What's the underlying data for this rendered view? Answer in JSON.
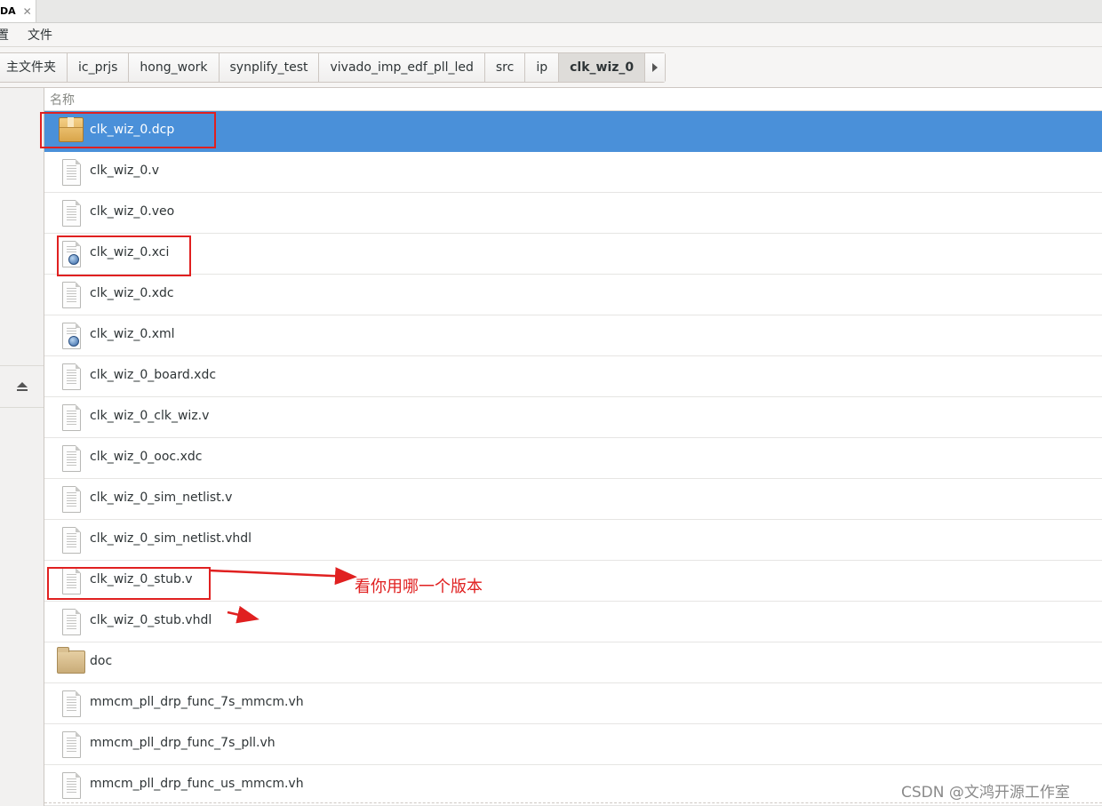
{
  "window_tab": {
    "label": "DA",
    "close_glyph": "✕"
  },
  "menu": {
    "items": [
      "置",
      "文件"
    ]
  },
  "breadcrumbs": [
    "主文件夹",
    "ic_prjs",
    "hong_work",
    "synplify_test",
    "vivado_imp_edf_pll_led",
    "src",
    "ip",
    "clk_wiz_0"
  ],
  "breadcrumb_active_index": 7,
  "list": {
    "column_header": "名称",
    "files": [
      {
        "name": "clk_wiz_0.dcp",
        "icon": "package-icon",
        "selected": true
      },
      {
        "name": "clk_wiz_0.v",
        "icon": "text-file-icon"
      },
      {
        "name": "clk_wiz_0.veo",
        "icon": "text-file-icon"
      },
      {
        "name": "clk_wiz_0.xci",
        "icon": "web-file-icon"
      },
      {
        "name": "clk_wiz_0.xdc",
        "icon": "text-file-icon"
      },
      {
        "name": "clk_wiz_0.xml",
        "icon": "web-file-icon"
      },
      {
        "name": "clk_wiz_0_board.xdc",
        "icon": "text-file-icon"
      },
      {
        "name": "clk_wiz_0_clk_wiz.v",
        "icon": "text-file-icon"
      },
      {
        "name": "clk_wiz_0_ooc.xdc",
        "icon": "text-file-icon"
      },
      {
        "name": "clk_wiz_0_sim_netlist.v",
        "icon": "text-file-icon"
      },
      {
        "name": "clk_wiz_0_sim_netlist.vhdl",
        "icon": "text-file-icon"
      },
      {
        "name": "clk_wiz_0_stub.v",
        "icon": "text-file-icon"
      },
      {
        "name": "clk_wiz_0_stub.vhdl",
        "icon": "text-file-icon"
      },
      {
        "name": "doc",
        "icon": "folder-icon"
      },
      {
        "name": "mmcm_pll_drp_func_7s_mmcm.vh",
        "icon": "text-file-icon"
      },
      {
        "name": "mmcm_pll_drp_func_7s_pll.vh",
        "icon": "text-file-icon"
      },
      {
        "name": "mmcm_pll_drp_func_us_mmcm.vh",
        "icon": "text-file-icon"
      }
    ]
  },
  "annotation": {
    "text": "看你用哪一个版本",
    "color": "#e02020"
  },
  "watermark": "CSDN @文鸿开源工作室",
  "colors": {
    "selection": "#4a90d9",
    "annotation": "#e02020"
  }
}
